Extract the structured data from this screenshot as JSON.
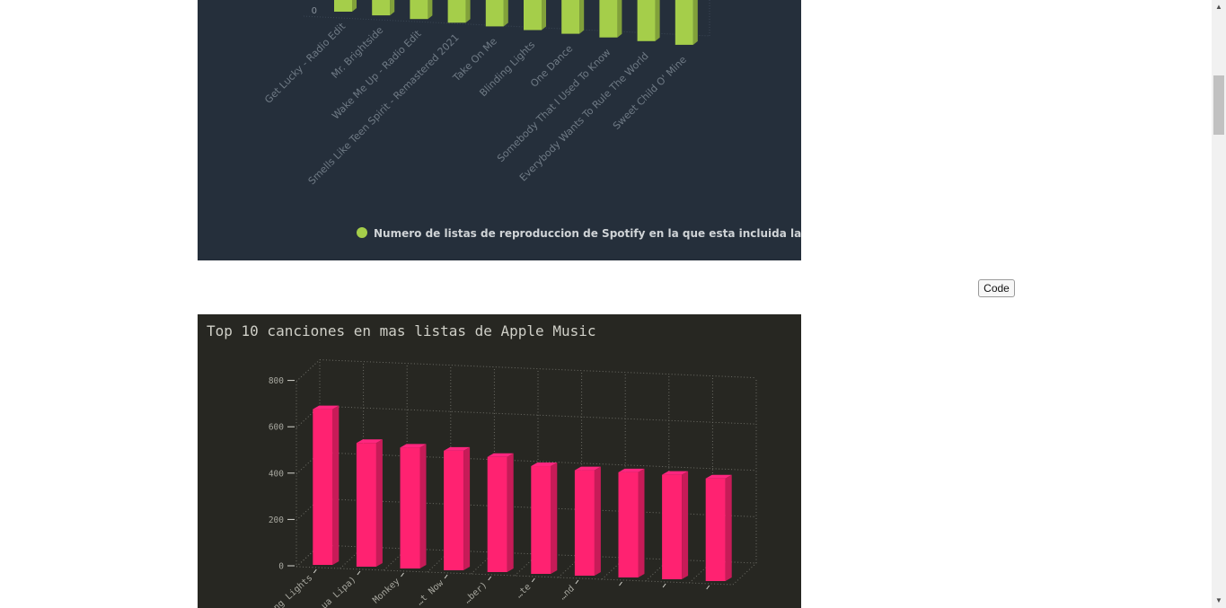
{
  "spotify_legend_color": "#a5ce4a",
  "apple_bar_color": "#ff2271",
  "ui": {
    "code_button_label": "Code"
  },
  "chart_data": [
    {
      "type": "bar",
      "style": "3d",
      "title": "",
      "visible_y_tick_labels": [
        "0"
      ],
      "categories": [
        "Get Lucky - Radio Edit",
        "Mr. Brightside",
        "Wake Me Up - Radio Edit",
        "Smells Like Teen Spirit - Remastered 2021",
        "Take On Me",
        "Blinding Lights",
        "One Dance",
        "Somebody That I Used To Know",
        "Everybody Wants To Rule The World",
        "Sweet Child O' Mine"
      ],
      "series": [
        {
          "name": "Numero de listas de reproduccion de Spotify en la que esta incluida la cancion",
          "color": "#a5ce4a"
        }
      ],
      "legend_position": "bottom-right",
      "background": "#252f3b"
    },
    {
      "type": "bar",
      "style": "3d",
      "title": "Top 10 canciones en mas listas de Apple Music",
      "categories": [
        "…ng Lights",
        "…ua Lipa)",
        "Monkey",
        "…t Now",
        "…ber)",
        "…te",
        "…nd",
        "",
        "",
        ""
      ],
      "values": [
        672,
        534,
        522,
        516,
        497,
        465,
        455,
        454,
        451,
        443
      ],
      "y_ticks": [
        "0",
        "200",
        "400",
        "600",
        "800"
      ],
      "ylim": [
        0,
        800
      ],
      "grid": true,
      "color": "#ff2271",
      "background": "#272722"
    }
  ]
}
